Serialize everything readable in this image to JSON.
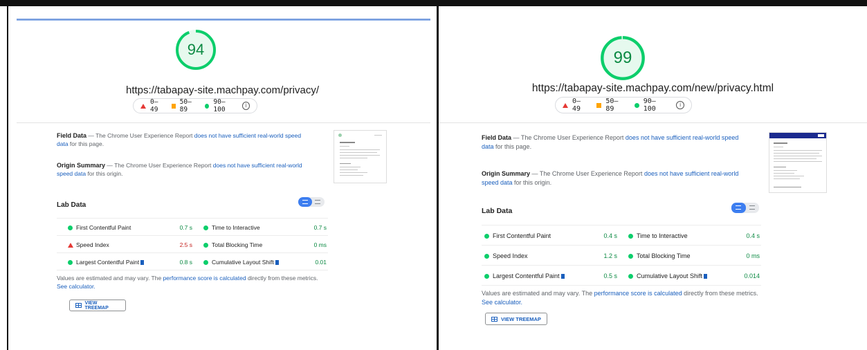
{
  "legend": {
    "range_fail": "0–49",
    "range_average": "50–89",
    "range_pass": "90–100",
    "info_glyph": "i"
  },
  "colors": {
    "pass": "#0cce6b",
    "average": "#ffa400",
    "fail": "#e53935",
    "link": "#1a5fbd"
  },
  "field_data": {
    "title": "Field Data",
    "prefix": " — The Chrome User Experience Report ",
    "link": "does not have sufficient real-world speed data",
    "suffix": " for this page."
  },
  "origin_summary": {
    "title": "Origin Summary",
    "prefix": " — The Chrome User Experience Report ",
    "link": "does not have sufficient real-world speed data",
    "suffix": " for this origin."
  },
  "lab_data_title": "Lab Data",
  "footnote": {
    "prefix": "Values are estimated and may vary. The ",
    "link1": "performance score is calculated",
    "middle": " directly from these metrics. ",
    "link2": "See calculator."
  },
  "treemap_label": "VIEW TREEMAP",
  "reports": [
    {
      "score": "94",
      "score_fraction": 0.94,
      "url": "https://tabapay-site.machpay.com/privacy/",
      "metrics": {
        "fcp": {
          "label": "First Contentful Paint",
          "value": "0.7 s",
          "status": "pass"
        },
        "tti": {
          "label": "Time to Interactive",
          "value": "0.7 s",
          "status": "pass"
        },
        "si": {
          "label": "Speed Index",
          "value": "2.5 s",
          "status": "fail"
        },
        "tbt": {
          "label": "Total Blocking Time",
          "value": "0 ms",
          "status": "pass"
        },
        "lcp": {
          "label": "Largest Contentful Paint",
          "value": "0.8 s",
          "status": "pass"
        },
        "cls": {
          "label": "Cumulative Layout Shift",
          "value": "0.01",
          "status": "pass"
        }
      }
    },
    {
      "score": "99",
      "score_fraction": 0.99,
      "url": "https://tabapay-site.machpay.com/new/privacy.html",
      "metrics": {
        "fcp": {
          "label": "First Contentful Paint",
          "value": "0.4 s",
          "status": "pass"
        },
        "tti": {
          "label": "Time to Interactive",
          "value": "0.4 s",
          "status": "pass"
        },
        "si": {
          "label": "Speed Index",
          "value": "1.2 s",
          "status": "pass"
        },
        "tbt": {
          "label": "Total Blocking Time",
          "value": "0 ms",
          "status": "pass"
        },
        "lcp": {
          "label": "Largest Contentful Paint",
          "value": "0.5 s",
          "status": "pass"
        },
        "cls": {
          "label": "Cumulative Layout Shift",
          "value": "0.014",
          "status": "pass"
        }
      }
    }
  ]
}
